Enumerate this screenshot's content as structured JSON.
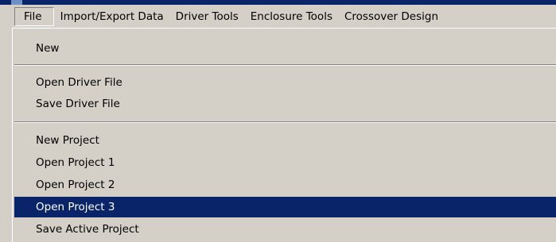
{
  "colors": {
    "menu_background": "#d4d0c8",
    "highlight_background": "#0a246a",
    "highlight_text": "#ffffff",
    "title_bar": "#0a246a"
  },
  "menubar": {
    "items": [
      {
        "label": "File"
      },
      {
        "label": "Import/Export Data"
      },
      {
        "label": "Driver Tools"
      },
      {
        "label": "Enclosure Tools"
      },
      {
        "label": "Crossover Design"
      }
    ],
    "open_item": "File"
  },
  "file_menu": {
    "items": [
      {
        "label": "New"
      },
      {
        "label": "Open Driver File"
      },
      {
        "label": "Save Driver File"
      },
      {
        "label": "New Project"
      },
      {
        "label": "Open Project 1"
      },
      {
        "label": "Open Project 2"
      },
      {
        "label": "Open Project 3"
      },
      {
        "label": "Save Active Project"
      }
    ],
    "highlighted_item": "Open Project 3"
  }
}
